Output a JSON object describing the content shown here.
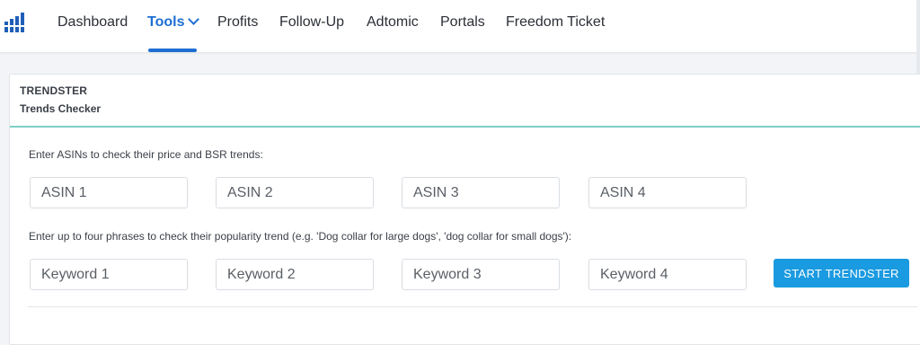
{
  "nav": {
    "logo": "bar-chart-logo",
    "items": [
      {
        "label": "Dashboard"
      },
      {
        "label": "Tools",
        "active": true,
        "has_dropdown": true
      },
      {
        "label": "Profits"
      },
      {
        "label": "Follow-Up"
      },
      {
        "label": "Adtomic"
      },
      {
        "label": "Portals"
      },
      {
        "label": "Freedom Ticket"
      }
    ],
    "active_color": "#1e6ed3"
  },
  "panel": {
    "title": "TRENDSTER",
    "subtitle": "Trends Checker",
    "asin_instructions": "Enter ASINs to check their price and BSR trends:",
    "asin_placeholders": [
      "ASIN 1",
      "ASIN 2",
      "ASIN 3",
      "ASIN 4"
    ],
    "keyword_instructions": "Enter up to four phrases to check their popularity trend (e.g. 'Dog collar for large dogs', 'dog collar for small dogs'):",
    "keyword_placeholders": [
      "Keyword 1",
      "Keyword 2",
      "Keyword 3",
      "Keyword 4"
    ],
    "start_button": "START TRENDSTER",
    "button_color": "#1a9ae0",
    "accent_line_color": "#7ecfc5"
  }
}
